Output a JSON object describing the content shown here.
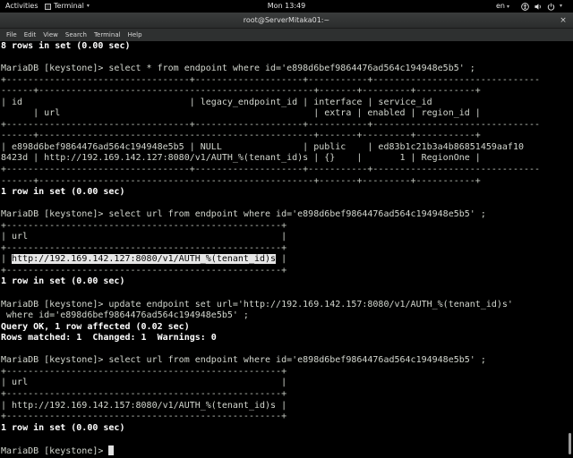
{
  "topbar": {
    "activities": "Activities",
    "app_name": "Terminal",
    "clock": "Mon 13:49",
    "language": "en",
    "icons": [
      "accessibility-icon",
      "volume-icon",
      "power-icon"
    ]
  },
  "window": {
    "title": "root@ServerMitaka01:~",
    "close_glyph": "×"
  },
  "menubar": {
    "items": [
      "File",
      "Edit",
      "View",
      "Search",
      "Terminal",
      "Help"
    ]
  },
  "terminal": {
    "lines": [
      {
        "text": "8 rows in set (0.00 sec)",
        "style": "b"
      },
      {
        "text": "",
        "style": ""
      },
      {
        "text": "MariaDB [keystone]> select * from endpoint where id='e898d6bef9864476ad564c194948e5b5' ;",
        "style": ""
      },
      {
        "text": "+----------------------------------+--------------------+-----------+-------------------------------",
        "style": "d"
      },
      {
        "text": "------+---------------------------------------------------+-------+---------+-----------+",
        "style": "d"
      },
      {
        "text": "| id                               | legacy_endpoint_id | interface | service_id",
        "style": ""
      },
      {
        "text": "      | url                                               | extra | enabled | region_id |",
        "style": ""
      },
      {
        "text": "+----------------------------------+--------------------+-----------+-------------------------------",
        "style": "d"
      },
      {
        "text": "------+---------------------------------------------------+-------+---------+-----------+",
        "style": "d"
      },
      {
        "text": "| e898d6bef9864476ad564c194948e5b5 | NULL               | public    | ed83b1c21b3a4b86851459aaf10",
        "style": ""
      },
      {
        "text": "8423d | http://192.169.142.127:8080/v1/AUTH_%(tenant_id)s | {}    |       1 | RegionOne |",
        "style": ""
      },
      {
        "text": "+----------------------------------+--------------------+-----------+-------------------------------",
        "style": "d"
      },
      {
        "text": "------+---------------------------------------------------+-------+---------+-----------+",
        "style": "d"
      },
      {
        "text": "1 row in set (0.00 sec)",
        "style": "b"
      },
      {
        "text": "",
        "style": ""
      },
      {
        "text": "MariaDB [keystone]> select url from endpoint where id='e898d6bef9864476ad564c194948e5b5' ;",
        "style": ""
      },
      {
        "text": "+---------------------------------------------------+",
        "style": "d"
      },
      {
        "text": "| url                                               |",
        "style": ""
      },
      {
        "text": "+---------------------------------------------------+",
        "style": "d"
      },
      {
        "text": "| ",
        "style": "",
        "selected": "http://192.169.142.127:8080/v1/AUTH_%(tenant_id)s",
        "after": " |"
      },
      {
        "text": "+---------------------------------------------------+",
        "style": "d"
      },
      {
        "text": "1 row in set (0.00 sec)",
        "style": "b"
      },
      {
        "text": "",
        "style": ""
      },
      {
        "text": "MariaDB [keystone]> update endpoint set url='http://192.169.142.157:8080/v1/AUTH_%(tenant_id)s'",
        "style": ""
      },
      {
        "text": " where id='e898d6bef9864476ad564c194948e5b5' ;",
        "style": ""
      },
      {
        "text": "Query OK, 1 row affected (0.02 sec)",
        "style": "b"
      },
      {
        "text": "Rows matched: 1  Changed: 1  Warnings: 0",
        "style": "b"
      },
      {
        "text": "",
        "style": ""
      },
      {
        "text": "MariaDB [keystone]> select url from endpoint where id='e898d6bef9864476ad564c194948e5b5' ;",
        "style": ""
      },
      {
        "text": "+---------------------------------------------------+",
        "style": "d"
      },
      {
        "text": "| url                                               |",
        "style": ""
      },
      {
        "text": "+---------------------------------------------------+",
        "style": "d"
      },
      {
        "text": "| http://192.169.142.157:8080/v1/AUTH_%(tenant_id)s |",
        "style": ""
      },
      {
        "text": "+---------------------------------------------------+",
        "style": "d"
      },
      {
        "text": "1 row in set (0.00 sec)",
        "style": "b"
      },
      {
        "text": "",
        "style": ""
      },
      {
        "text": "MariaDB [keystone]> ",
        "style": "",
        "cursor": true
      }
    ]
  }
}
